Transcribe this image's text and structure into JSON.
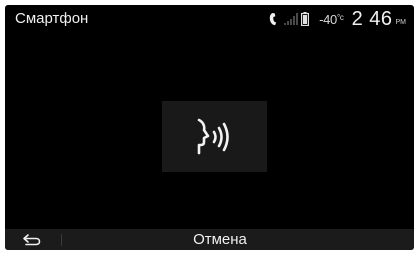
{
  "status_bar": {
    "app_title": "Смартфон",
    "temperature_value": "-40",
    "temperature_unit": "°c",
    "time": "2 46",
    "ampm": "PM",
    "icons": [
      "phone-icon",
      "signal-icon",
      "battery-icon"
    ]
  },
  "main": {
    "voice_icon": "voice-recognition-icon"
  },
  "bottom_bar": {
    "back_icon": "back-arrow-icon",
    "cancel_label": "Отмена"
  },
  "colors": {
    "background": "#000000",
    "bar": "#1b1b1b",
    "tile": "#191919",
    "text": "#f0f0f0"
  }
}
